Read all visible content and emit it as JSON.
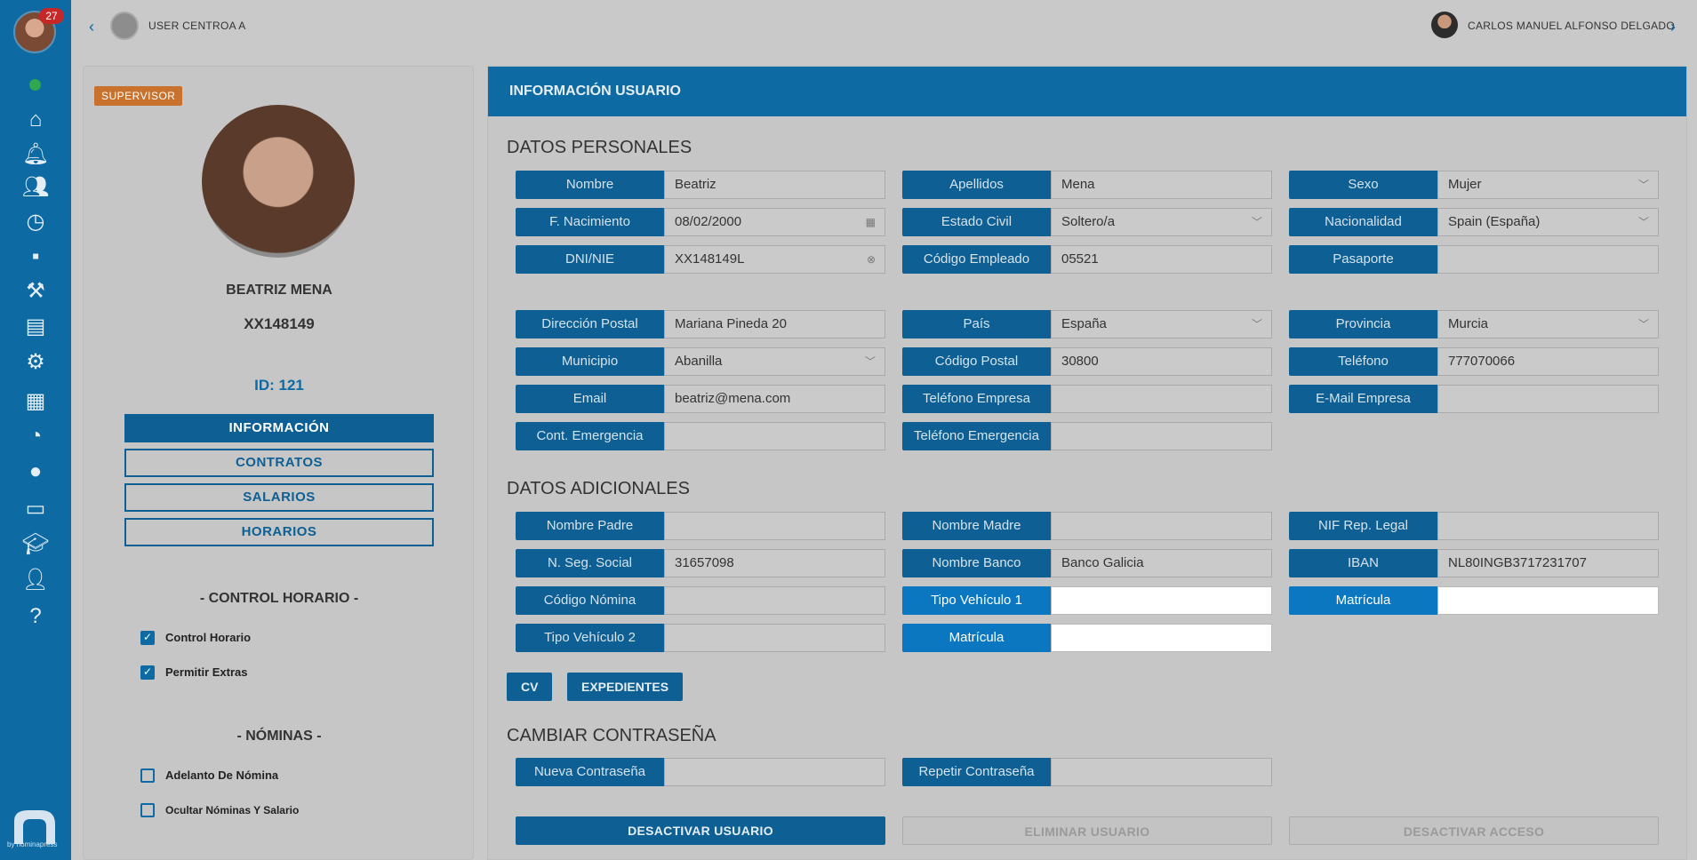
{
  "rail": {
    "notification_count": "27",
    "icons": [
      "home-icon",
      "bell-icon",
      "users-icon",
      "clock-icon",
      "briefcase-icon",
      "tools-icon",
      "id-card-icon",
      "gear-icon",
      "clipboard-icon",
      "pie-chart-icon",
      "chat-icon",
      "folder-icon",
      "graduation-icon",
      "user-salary-icon",
      "help-icon"
    ],
    "brand_text": "by nominapress"
  },
  "topbar": {
    "center_name": "USER CENTROA A",
    "user_name": "CARLOS MANUEL ALFONSO DELGADO"
  },
  "profile": {
    "role": "SUPERVISOR",
    "name": "BEATRIZ MENA",
    "dni": "XX148149",
    "id_label": "ID: 121",
    "nav": [
      "INFORMACIÓN",
      "CONTRATOS",
      "SALARIOS",
      "HORARIOS"
    ],
    "control_title": "- CONTROL HORARIO -",
    "control_items": [
      {
        "label": "Control Horario",
        "checked": true
      },
      {
        "label": "Permitir Extras",
        "checked": true
      }
    ],
    "nominas_title": "- NÓMINAS -",
    "nominas_items": [
      {
        "label": "Adelanto De Nómina",
        "checked": false
      },
      {
        "label": "Ocultar Nóminas Y Salario",
        "checked": false
      }
    ]
  },
  "panel": {
    "title": "INFORMACIÓN USUARIO",
    "personal_title": "DATOS PERSONALES",
    "additional_title": "DATOS ADICIONALES",
    "password_title": "CAMBIAR CONTRASEÑA",
    "fields": {
      "nombre": {
        "label": "Nombre",
        "value": "Beatriz"
      },
      "apellidos": {
        "label": "Apellidos",
        "value": "Mena"
      },
      "sexo": {
        "label": "Sexo",
        "value": "Mujer"
      },
      "nacimiento": {
        "label": "F. Nacimiento",
        "value": "08/02/2000"
      },
      "estado_civil": {
        "label": "Estado Civil",
        "value": "Soltero/a"
      },
      "nacionalidad": {
        "label": "Nacionalidad",
        "value": "Spain (España)"
      },
      "dni": {
        "label": "DNI/NIE",
        "value": "XX148149L"
      },
      "codigo_empleado": {
        "label": "Código Empleado",
        "value": "05521"
      },
      "pasaporte": {
        "label": "Pasaporte",
        "value": ""
      },
      "direccion": {
        "label": "Dirección Postal",
        "value": "Mariana Pineda 20"
      },
      "pais": {
        "label": "País",
        "value": "España"
      },
      "provincia": {
        "label": "Provincia",
        "value": "Murcia"
      },
      "municipio": {
        "label": "Municipio",
        "value": "Abanilla"
      },
      "codigo_postal": {
        "label": "Código Postal",
        "value": "30800"
      },
      "telefono": {
        "label": "Teléfono",
        "value": "777070066"
      },
      "email": {
        "label": "Email",
        "value": "beatriz@mena.com"
      },
      "telefono_empresa": {
        "label": "Teléfono Empresa",
        "value": ""
      },
      "email_empresa": {
        "label": "E-Mail Empresa",
        "value": ""
      },
      "cont_emergencia": {
        "label": "Cont. Emergencia",
        "value": ""
      },
      "telefono_emergencia": {
        "label": "Teléfono Emergencia",
        "value": ""
      },
      "nombre_padre": {
        "label": "Nombre Padre",
        "value": ""
      },
      "nombre_madre": {
        "label": "Nombre Madre",
        "value": ""
      },
      "nif_rep": {
        "label": "NIF Rep. Legal",
        "value": ""
      },
      "seg_social": {
        "label": "N. Seg. Social",
        "value": "31657098"
      },
      "nombre_banco": {
        "label": "Nombre Banco",
        "value": "Banco Galicia"
      },
      "iban": {
        "label": "IBAN",
        "value": "NL80INGB3717231707"
      },
      "codigo_nomina": {
        "label": "Código Nómina",
        "value": ""
      },
      "tipo_vehiculo_1": {
        "label": "Tipo Vehículo 1",
        "value": ""
      },
      "matricula_1": {
        "label": "Matrícula",
        "value": ""
      },
      "tipo_vehiculo_2": {
        "label": "Tipo Vehículo 2",
        "value": ""
      },
      "matricula_2": {
        "label": "Matrícula",
        "value": ""
      },
      "nueva_pass": {
        "label": "Nueva Contraseña",
        "value": ""
      },
      "repetir_pass": {
        "label": "Repetir Contraseña",
        "value": ""
      }
    },
    "buttons": {
      "cv": "CV",
      "expedientes": "EXPEDIENTES",
      "desactivar_usuario": "DESACTIVAR USUARIO",
      "eliminar_usuario": "ELIMINAR USUARIO",
      "desactivar_acceso": "DESACTIVAR ACCESO"
    }
  }
}
